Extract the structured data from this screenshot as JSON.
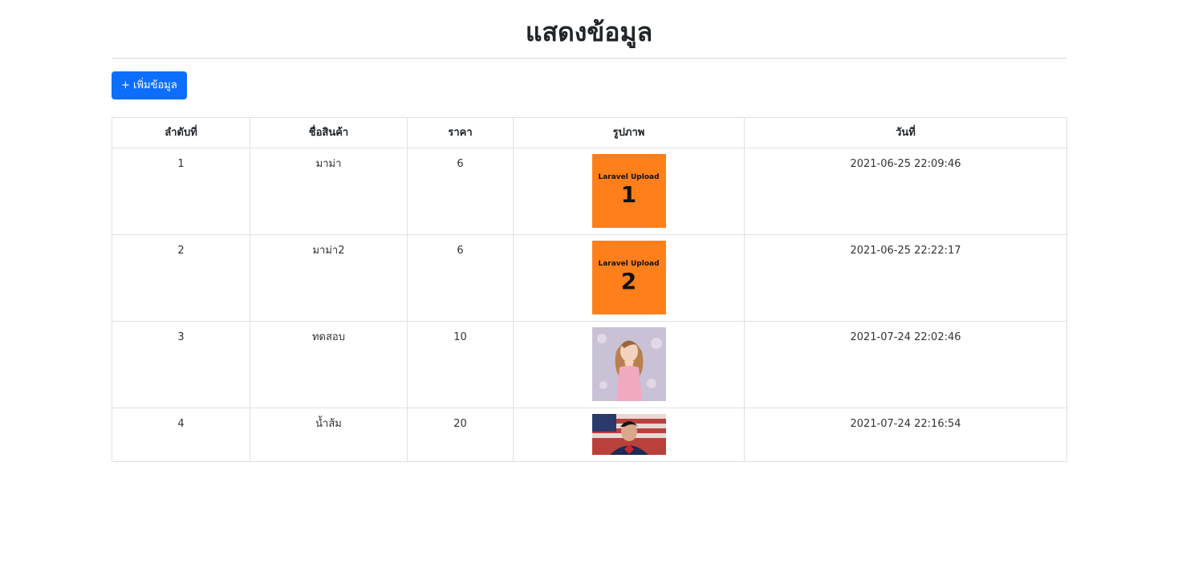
{
  "page": {
    "title": "แสดงข้อมูล",
    "add_button_label": "+ เพิ่มข้อมูล"
  },
  "table": {
    "headers": [
      "ลำดับที่",
      "ชื่อสินค้า",
      "ราคา",
      "รูปภาพ",
      "วันที่"
    ],
    "rows": [
      {
        "index": "1",
        "name": "มาม่า",
        "price": "6",
        "image": "laravel-upload-1",
        "image_caption": "Laravel Upload",
        "image_number": "1",
        "date": "2021-06-25 22:09:46"
      },
      {
        "index": "2",
        "name": "มาม่า2",
        "price": "6",
        "image": "laravel-upload-2",
        "image_caption": "Laravel Upload",
        "image_number": "2",
        "date": "2021-06-25 22:22:17"
      },
      {
        "index": "3",
        "name": "ทดสอบ",
        "price": "10",
        "image": "anime-girl-illustration",
        "date": "2021-07-24 22:02:46"
      },
      {
        "index": "4",
        "name": "น้ำส้ม",
        "price": "20",
        "image": "superman-photo",
        "date": "2021-07-24 22:16:54"
      }
    ]
  },
  "colors": {
    "primary": "#0d6efd",
    "thumbnail_orange": "#ff7f1a",
    "border": "#dee2e6"
  }
}
